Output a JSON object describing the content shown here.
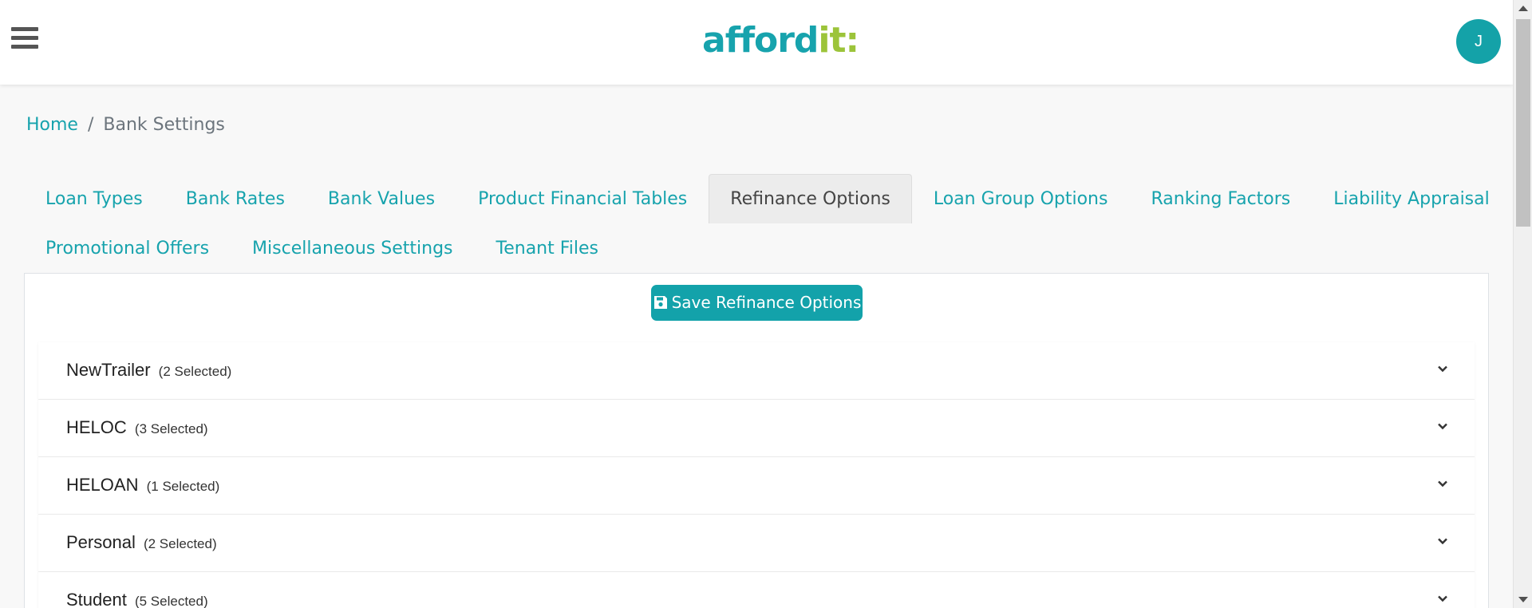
{
  "header": {
    "logo_main": "afford",
    "logo_accent": "it:",
    "avatar_initial": "J"
  },
  "breadcrumb": {
    "home": "Home",
    "separator": "/",
    "current": "Bank Settings"
  },
  "tabs": [
    {
      "label": "Loan Types"
    },
    {
      "label": "Bank Rates"
    },
    {
      "label": "Bank Values"
    },
    {
      "label": "Product Financial Tables"
    },
    {
      "label": "Refinance Options"
    },
    {
      "label": "Loan Group Options"
    },
    {
      "label": "Ranking Factors"
    },
    {
      "label": "Liability Appraisal"
    },
    {
      "label": "Promotional Offers"
    },
    {
      "label": "Miscellaneous Settings"
    },
    {
      "label": "Tenant Files"
    }
  ],
  "active_tab": "Refinance Options",
  "save_button": {
    "label": "Save Refinance Options",
    "icon": "save-icon"
  },
  "accordion": [
    {
      "name": "NewTrailer",
      "count": "(2 Selected)"
    },
    {
      "name": "HELOC",
      "count": "(3 Selected)"
    },
    {
      "name": "HELOAN",
      "count": "(1 Selected)"
    },
    {
      "name": "Personal",
      "count": "(2 Selected)"
    },
    {
      "name": "Student",
      "count": "(5 Selected)"
    }
  ],
  "colors": {
    "brand": "#17a3ad",
    "brand_accent": "#9cc43a",
    "button": "#13a2aa"
  }
}
